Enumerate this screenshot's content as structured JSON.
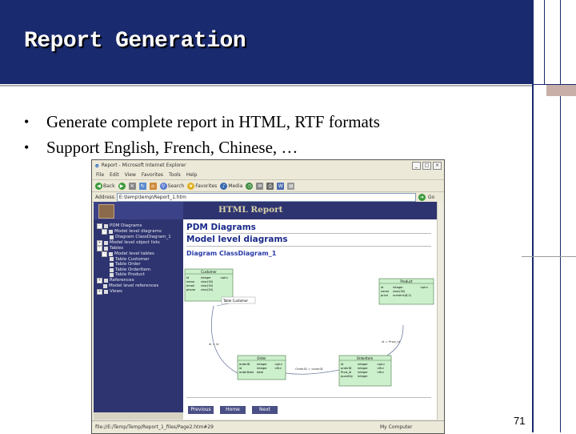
{
  "slide": {
    "title": "Report Generation",
    "bullets": [
      "Generate complete report in HTML, RTF formats",
      "Support English, French, Chinese, …"
    ],
    "bullet_symbol": "•",
    "page_number": "71"
  },
  "browser": {
    "window_title": "Report - Microsoft Internet Explorer",
    "controls": {
      "minimize": "_",
      "maximize": "□",
      "close": "×"
    },
    "menu": [
      "File",
      "Edit",
      "View",
      "Favorites",
      "Tools",
      "Help"
    ],
    "toolbar": {
      "back": "Back",
      "search": "Search",
      "favorites": "Favorites",
      "media": "Media"
    },
    "address_label": "Address",
    "address_value": "E:\\temp\\temp\\Report_1.htm",
    "go_label": "Go",
    "status_text": "file://E:/Temp/Temp/Report_1_files/Page2.htm#29",
    "status_zone": "My Computer"
  },
  "report": {
    "banner_title": "HTML Report",
    "tree": [
      {
        "label": "PDM Diagrams",
        "indent": 0,
        "toggle": "-"
      },
      {
        "label": "Model level diagrams",
        "indent": 1,
        "toggle": "-"
      },
      {
        "label": "Diagram ClassDiagram_1",
        "indent": 2,
        "toggle": ""
      },
      {
        "label": "Model level object lists",
        "indent": 0,
        "toggle": "+"
      },
      {
        "label": "Tables",
        "indent": 0,
        "toggle": "-"
      },
      {
        "label": "Model level tables",
        "indent": 1,
        "toggle": "-"
      },
      {
        "label": "Table Customer",
        "indent": 2,
        "toggle": ""
      },
      {
        "label": "Table Order",
        "indent": 2,
        "toggle": ""
      },
      {
        "label": "Table OrderItem",
        "indent": 2,
        "toggle": ""
      },
      {
        "label": "Table Product",
        "indent": 2,
        "toggle": ""
      },
      {
        "label": "References",
        "indent": 0,
        "toggle": "+"
      },
      {
        "label": "Model level references",
        "indent": 1,
        "toggle": ""
      },
      {
        "label": "Views",
        "indent": 0,
        "toggle": "+"
      }
    ],
    "heading_pdm": "PDM Diagrams",
    "heading_model": "Model level diagrams",
    "heading_diagram": "Diagram ClassDiagram_1",
    "nav": {
      "previous": "Previous",
      "home": "Home",
      "next": "Next"
    }
  },
  "diagram_tables": [
    {
      "name": "Customer",
      "rows": [
        [
          "id",
          "integer",
          "<pk>"
        ],
        [
          "name",
          "char(30)",
          ""
        ],
        [
          "email",
          "char(30)",
          ""
        ],
        [
          "phone",
          "char(20)",
          ""
        ]
      ]
    },
    {
      "name": "Product",
      "rows": [
        [
          "id",
          "integer",
          "<pk>"
        ],
        [
          "name",
          "char(30)",
          ""
        ],
        [
          "price",
          "numeric(8,2)",
          ""
        ]
      ]
    },
    {
      "name": "Order",
      "rows": [
        [
          "orderID",
          "integer",
          "<pk>"
        ],
        [
          "id",
          "integer",
          "<fk>"
        ],
        [
          "orderDate",
          "date",
          ""
        ]
      ]
    },
    {
      "name": "OrderItem",
      "rows": [
        [
          "id",
          "integer",
          "<pk>"
        ],
        [
          "orderID",
          "integer",
          "<fk>"
        ],
        [
          "Prod_id",
          "integer",
          "<fk>"
        ],
        [
          "quantity",
          "integer",
          ""
        ]
      ]
    }
  ],
  "diagram_labels": {
    "customer_link": "Table Customer",
    "id_label": "id = id",
    "order_link": "OrderID = orderID",
    "prod_link": "id = Prod_id"
  },
  "colors": {
    "slide_navy": "#1a2a6e",
    "report_navy": "#2e3470",
    "table_green": "#ccf0cc"
  }
}
